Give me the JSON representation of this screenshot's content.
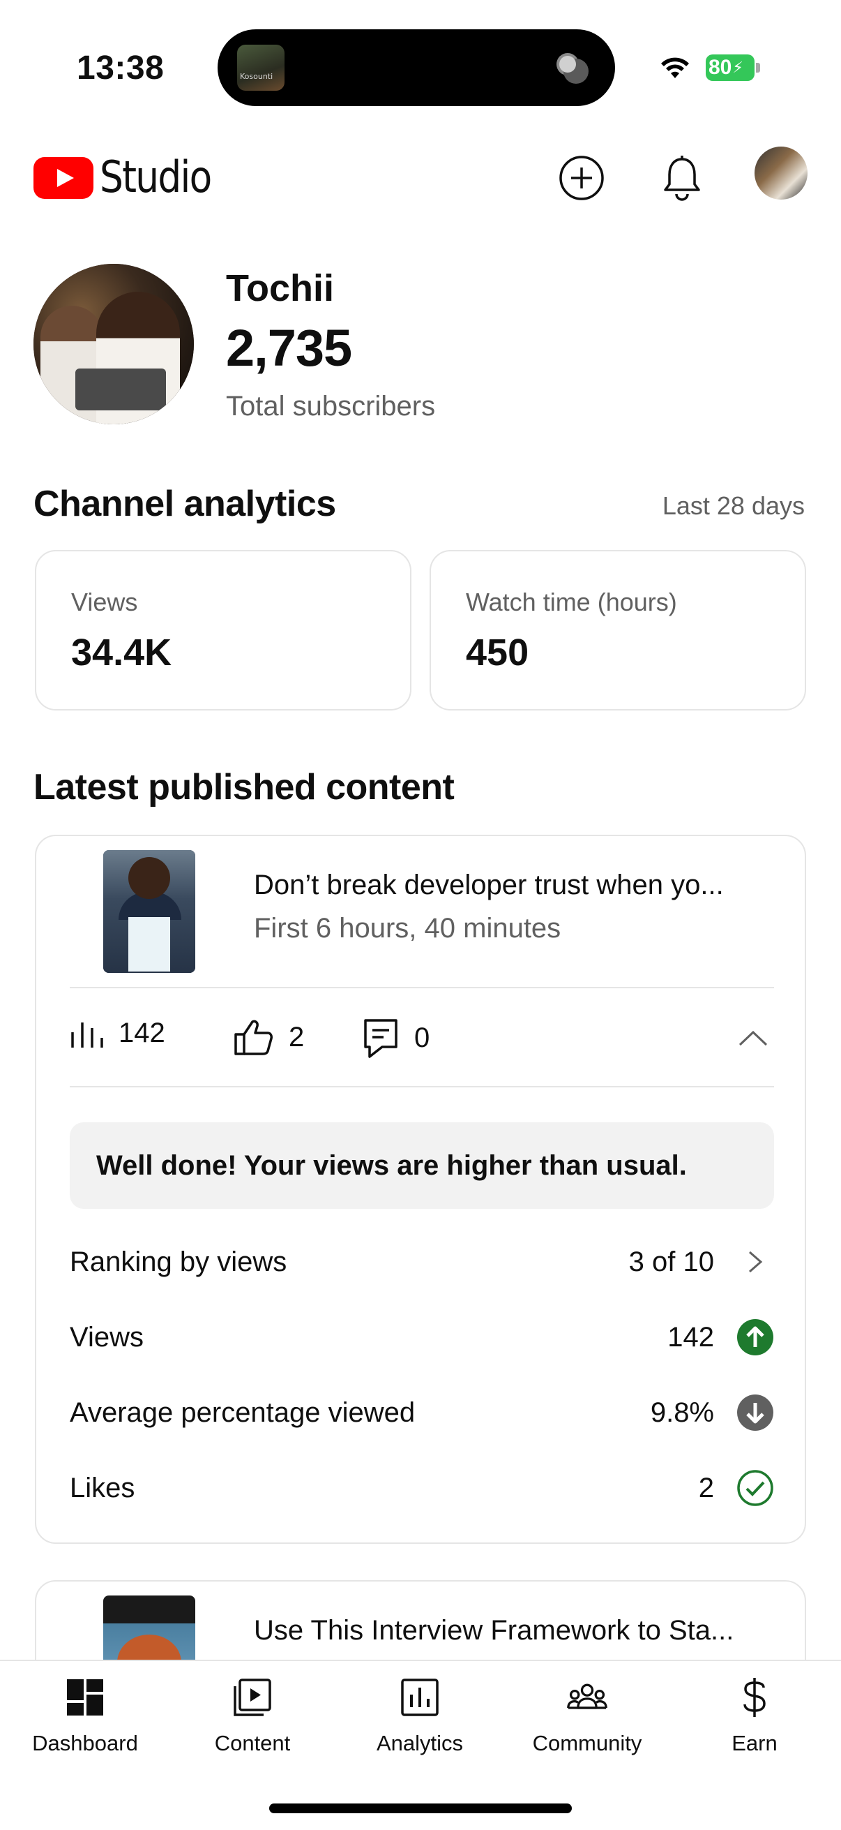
{
  "status_bar": {
    "time": "13:38",
    "island_thumb_text": "Kosounti",
    "battery": "80"
  },
  "header": {
    "app_name": "Studio"
  },
  "profile": {
    "channel_name": "Tochii",
    "subscribers": "2,735",
    "subscribers_label": "Total subscribers"
  },
  "analytics": {
    "title": "Channel analytics",
    "period": "Last 28 days",
    "cards": [
      {
        "label": "Views",
        "value": "34.4K"
      },
      {
        "label": "Watch time (hours)",
        "value": "450"
      }
    ]
  },
  "latest": {
    "title": "Latest published content",
    "video": {
      "title": "Don’t break developer trust when yo...",
      "subtitle": "First 6 hours, 40 minutes",
      "views": "142",
      "likes": "2",
      "comments": "0"
    },
    "banner": "Well done! Your views are higher than usual.",
    "details": [
      {
        "label": "Ranking by views",
        "value": "3 of 10",
        "icon": "chevron-right-icon"
      },
      {
        "label": "Views",
        "value": "142",
        "icon": "arrow-up-circle-icon",
        "color": "#1e7a2e"
      },
      {
        "label": "Average percentage viewed",
        "value": "9.8%",
        "icon": "arrow-down-circle-icon",
        "color": "#606060"
      },
      {
        "label": "Likes",
        "value": "2",
        "icon": "check-circle-icon",
        "color": "#1e7a2e"
      }
    ],
    "next_video_title": "Use This Interview Framework to Sta..."
  },
  "nav": [
    {
      "label": "Dashboard",
      "icon": "dashboard-icon"
    },
    {
      "label": "Content",
      "icon": "content-icon"
    },
    {
      "label": "Analytics",
      "icon": "analytics-icon"
    },
    {
      "label": "Community",
      "icon": "community-icon"
    },
    {
      "label": "Earn",
      "icon": "dollar-icon"
    }
  ],
  "colors": {
    "brand_red": "#ff0000",
    "text_primary": "#0f0f0f",
    "text_secondary": "#606060",
    "positive": "#1e7a2e",
    "battery_green": "#34c759"
  }
}
